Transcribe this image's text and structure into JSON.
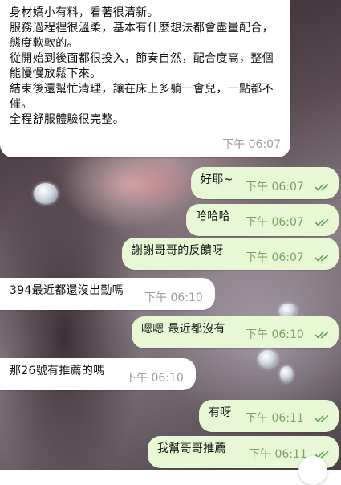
{
  "messages": [
    {
      "direction": "in",
      "text": "身材嬌小有料，看著很清新。\n服務過程裡很溫柔，基本有什麼想法都會盡量配合，態度軟軟的。\n從開始到後面都很投入，節奏自然，配合度高，整個能慢慢放鬆下來。\n結束後還幫忙清理，讓在床上多躺一會兒，一點都不催。\n全程舒服體驗很完整。",
      "time": "下午 06:07"
    },
    {
      "direction": "out",
      "text": "好耶~",
      "time": "下午 06:07",
      "read": true
    },
    {
      "direction": "out",
      "text": "哈哈哈",
      "time": "下午 06:07",
      "read": true
    },
    {
      "direction": "out",
      "text": "謝謝哥哥的反饋呀",
      "time": "下午 06:07",
      "read": true
    },
    {
      "direction": "in",
      "text": "394最近都還沒出勤嗎",
      "time": "下午 06:10"
    },
    {
      "direction": "out",
      "text": "嗯嗯 最近都沒有",
      "time": "下午 06:10",
      "read": true
    },
    {
      "direction": "in",
      "text": "那26號有推薦的嗎",
      "time": "下午 06:10"
    },
    {
      "direction": "out",
      "text": "有呀",
      "time": "下午 06:11",
      "read": true
    },
    {
      "direction": "out",
      "text": "我幫哥哥推薦",
      "time": "下午 06:11",
      "read": true
    }
  ],
  "colors": {
    "incoming_bubble": "#ffffff",
    "outgoing_bubble": "#e9f8d4",
    "read_check": "#5aa05a"
  },
  "icons": {
    "read_receipt": "double-check-icon"
  }
}
